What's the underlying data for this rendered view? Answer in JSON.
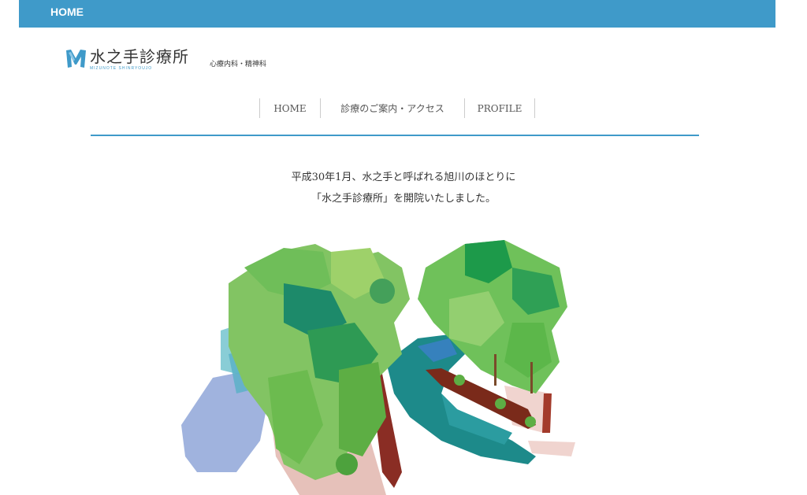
{
  "topbar": {
    "home_label": "HOME"
  },
  "logo": {
    "title": "水之手診療所",
    "subtitle": "MIZUNOTE SHINRYOUJO",
    "mark_icon": "clinic-logo-mark-icon",
    "color": "#3f9ac9"
  },
  "tagline": "心療内科・精神科",
  "nav": [
    {
      "label": "HOME"
    },
    {
      "label": "診療のご案内・アクセス"
    },
    {
      "label": "PROFILE"
    }
  ],
  "intro": {
    "line1": "平成30年1月、水之手と呼ばれる旭川のほとりに",
    "line2": "「水之手診療所」を開院いたしました。"
  },
  "colors": {
    "accent": "#3f9ac9"
  }
}
